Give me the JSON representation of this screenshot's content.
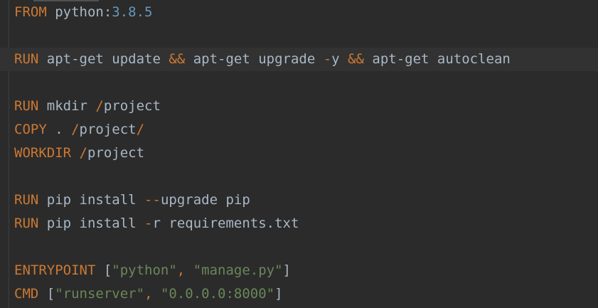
{
  "editor": {
    "lines": [
      [
        {
          "t": "kw",
          "v": "FROM"
        },
        {
          "t": "plain",
          "v": " python:"
        },
        {
          "t": "num",
          "v": "3.8.5"
        }
      ],
      [],
      [
        {
          "t": "kw",
          "v": "RUN"
        },
        {
          "t": "plain",
          "v": " apt-get update "
        },
        {
          "t": "op",
          "v": "&&"
        },
        {
          "t": "plain",
          "v": " apt-get upgrade "
        },
        {
          "t": "op",
          "v": "-"
        },
        {
          "t": "plain",
          "v": "y "
        },
        {
          "t": "op",
          "v": "&&"
        },
        {
          "t": "plain",
          "v": " apt-get autoclean"
        }
      ],
      [],
      [
        {
          "t": "kw",
          "v": "RUN"
        },
        {
          "t": "plain",
          "v": " mkdir "
        },
        {
          "t": "op",
          "v": "/"
        },
        {
          "t": "plain",
          "v": "project"
        }
      ],
      [
        {
          "t": "kw",
          "v": "COPY"
        },
        {
          "t": "plain",
          "v": " . "
        },
        {
          "t": "op",
          "v": "/"
        },
        {
          "t": "plain",
          "v": "project"
        },
        {
          "t": "op",
          "v": "/"
        }
      ],
      [
        {
          "t": "kw",
          "v": "WORKDIR"
        },
        {
          "t": "plain",
          "v": " "
        },
        {
          "t": "op",
          "v": "/"
        },
        {
          "t": "plain",
          "v": "project"
        }
      ],
      [],
      [
        {
          "t": "kw",
          "v": "RUN"
        },
        {
          "t": "plain",
          "v": " pip install "
        },
        {
          "t": "op",
          "v": "--"
        },
        {
          "t": "plain",
          "v": "upgrade pip"
        }
      ],
      [
        {
          "t": "kw",
          "v": "RUN"
        },
        {
          "t": "plain",
          "v": " pip install "
        },
        {
          "t": "op",
          "v": "-"
        },
        {
          "t": "plain",
          "v": "r requirements.txt"
        }
      ],
      [],
      [
        {
          "t": "kw",
          "v": "ENTRYPOINT"
        },
        {
          "t": "plain",
          "v": " ["
        },
        {
          "t": "str",
          "v": "\"python\""
        },
        {
          "t": "op",
          "v": ","
        },
        {
          "t": "plain",
          "v": " "
        },
        {
          "t": "str",
          "v": "\"manage.py\""
        },
        {
          "t": "plain",
          "v": "]"
        }
      ],
      [
        {
          "t": "kw",
          "v": "CMD"
        },
        {
          "t": "plain",
          "v": " ["
        },
        {
          "t": "str",
          "v": "\"runserver\""
        },
        {
          "t": "op",
          "v": ","
        },
        {
          "t": "plain",
          "v": " "
        },
        {
          "t": "str",
          "v": "\"0.0.0.0:8000\""
        },
        {
          "t": "plain",
          "v": "]"
        }
      ]
    ],
    "current_line": 2
  }
}
